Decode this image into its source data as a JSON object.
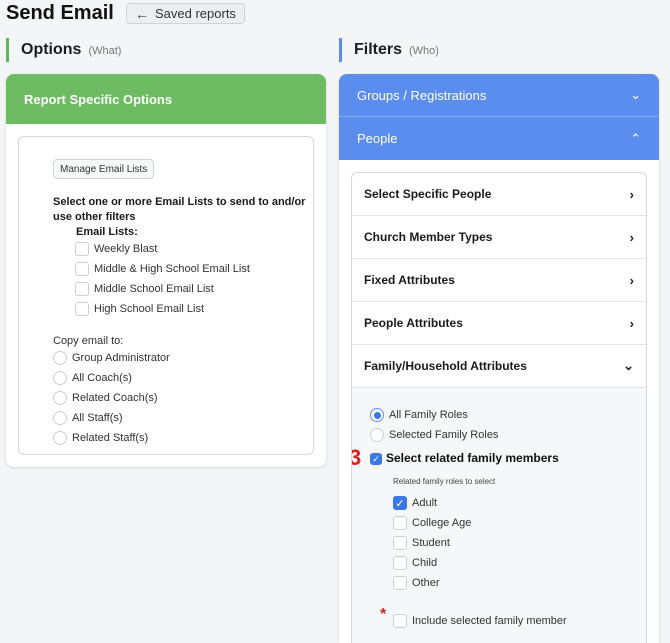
{
  "page": {
    "title": "Send Email"
  },
  "back_button": {
    "label": "Saved reports",
    "icon": "arrow-left-icon"
  },
  "sections": {
    "options": {
      "title": "Options",
      "subtitle": "(What)",
      "accent": "#5cb85c"
    },
    "filters": {
      "title": "Filters",
      "subtitle": "(Who)",
      "accent": "#5b8def"
    }
  },
  "options_card": {
    "header": "Report Specific Options",
    "manage_button": "Manage Email Lists",
    "instruction": "Select one or more Email Lists to send to and/or use other filters",
    "email_lists_label": "Email Lists:",
    "email_lists": [
      "Weekly Blast",
      "Middle & High School Email List",
      "Middle School Email List",
      "High School Email List"
    ],
    "copy_label": "Copy email to:",
    "copy_options": [
      "Group Administrator",
      "All Coach(s)",
      "Related Coach(s)",
      "All Staff(s)",
      "Related Staff(s)"
    ]
  },
  "filters_panel": {
    "groups_row": "Groups / Registrations",
    "people_row": "People",
    "attributes": [
      "Select Specific People",
      "Church Member Types",
      "Fixed Attributes",
      "People Attributes"
    ],
    "family_row": "Family/Household Attributes",
    "roles_radio": [
      "All Family Roles",
      "Selected Family Roles"
    ],
    "selected_radio": "All Family Roles",
    "annotation_number": "3",
    "related_label": "Select related family members",
    "related_checked": true,
    "roles_caption": "Related family roles to select",
    "roles": [
      {
        "label": "Adult",
        "checked": true
      },
      {
        "label": "College Age",
        "checked": false
      },
      {
        "label": "Student",
        "checked": false
      },
      {
        "label": "Child",
        "checked": false
      },
      {
        "label": "Other",
        "checked": false
      }
    ],
    "required_marker": "*",
    "include_label": "Include selected family member"
  }
}
